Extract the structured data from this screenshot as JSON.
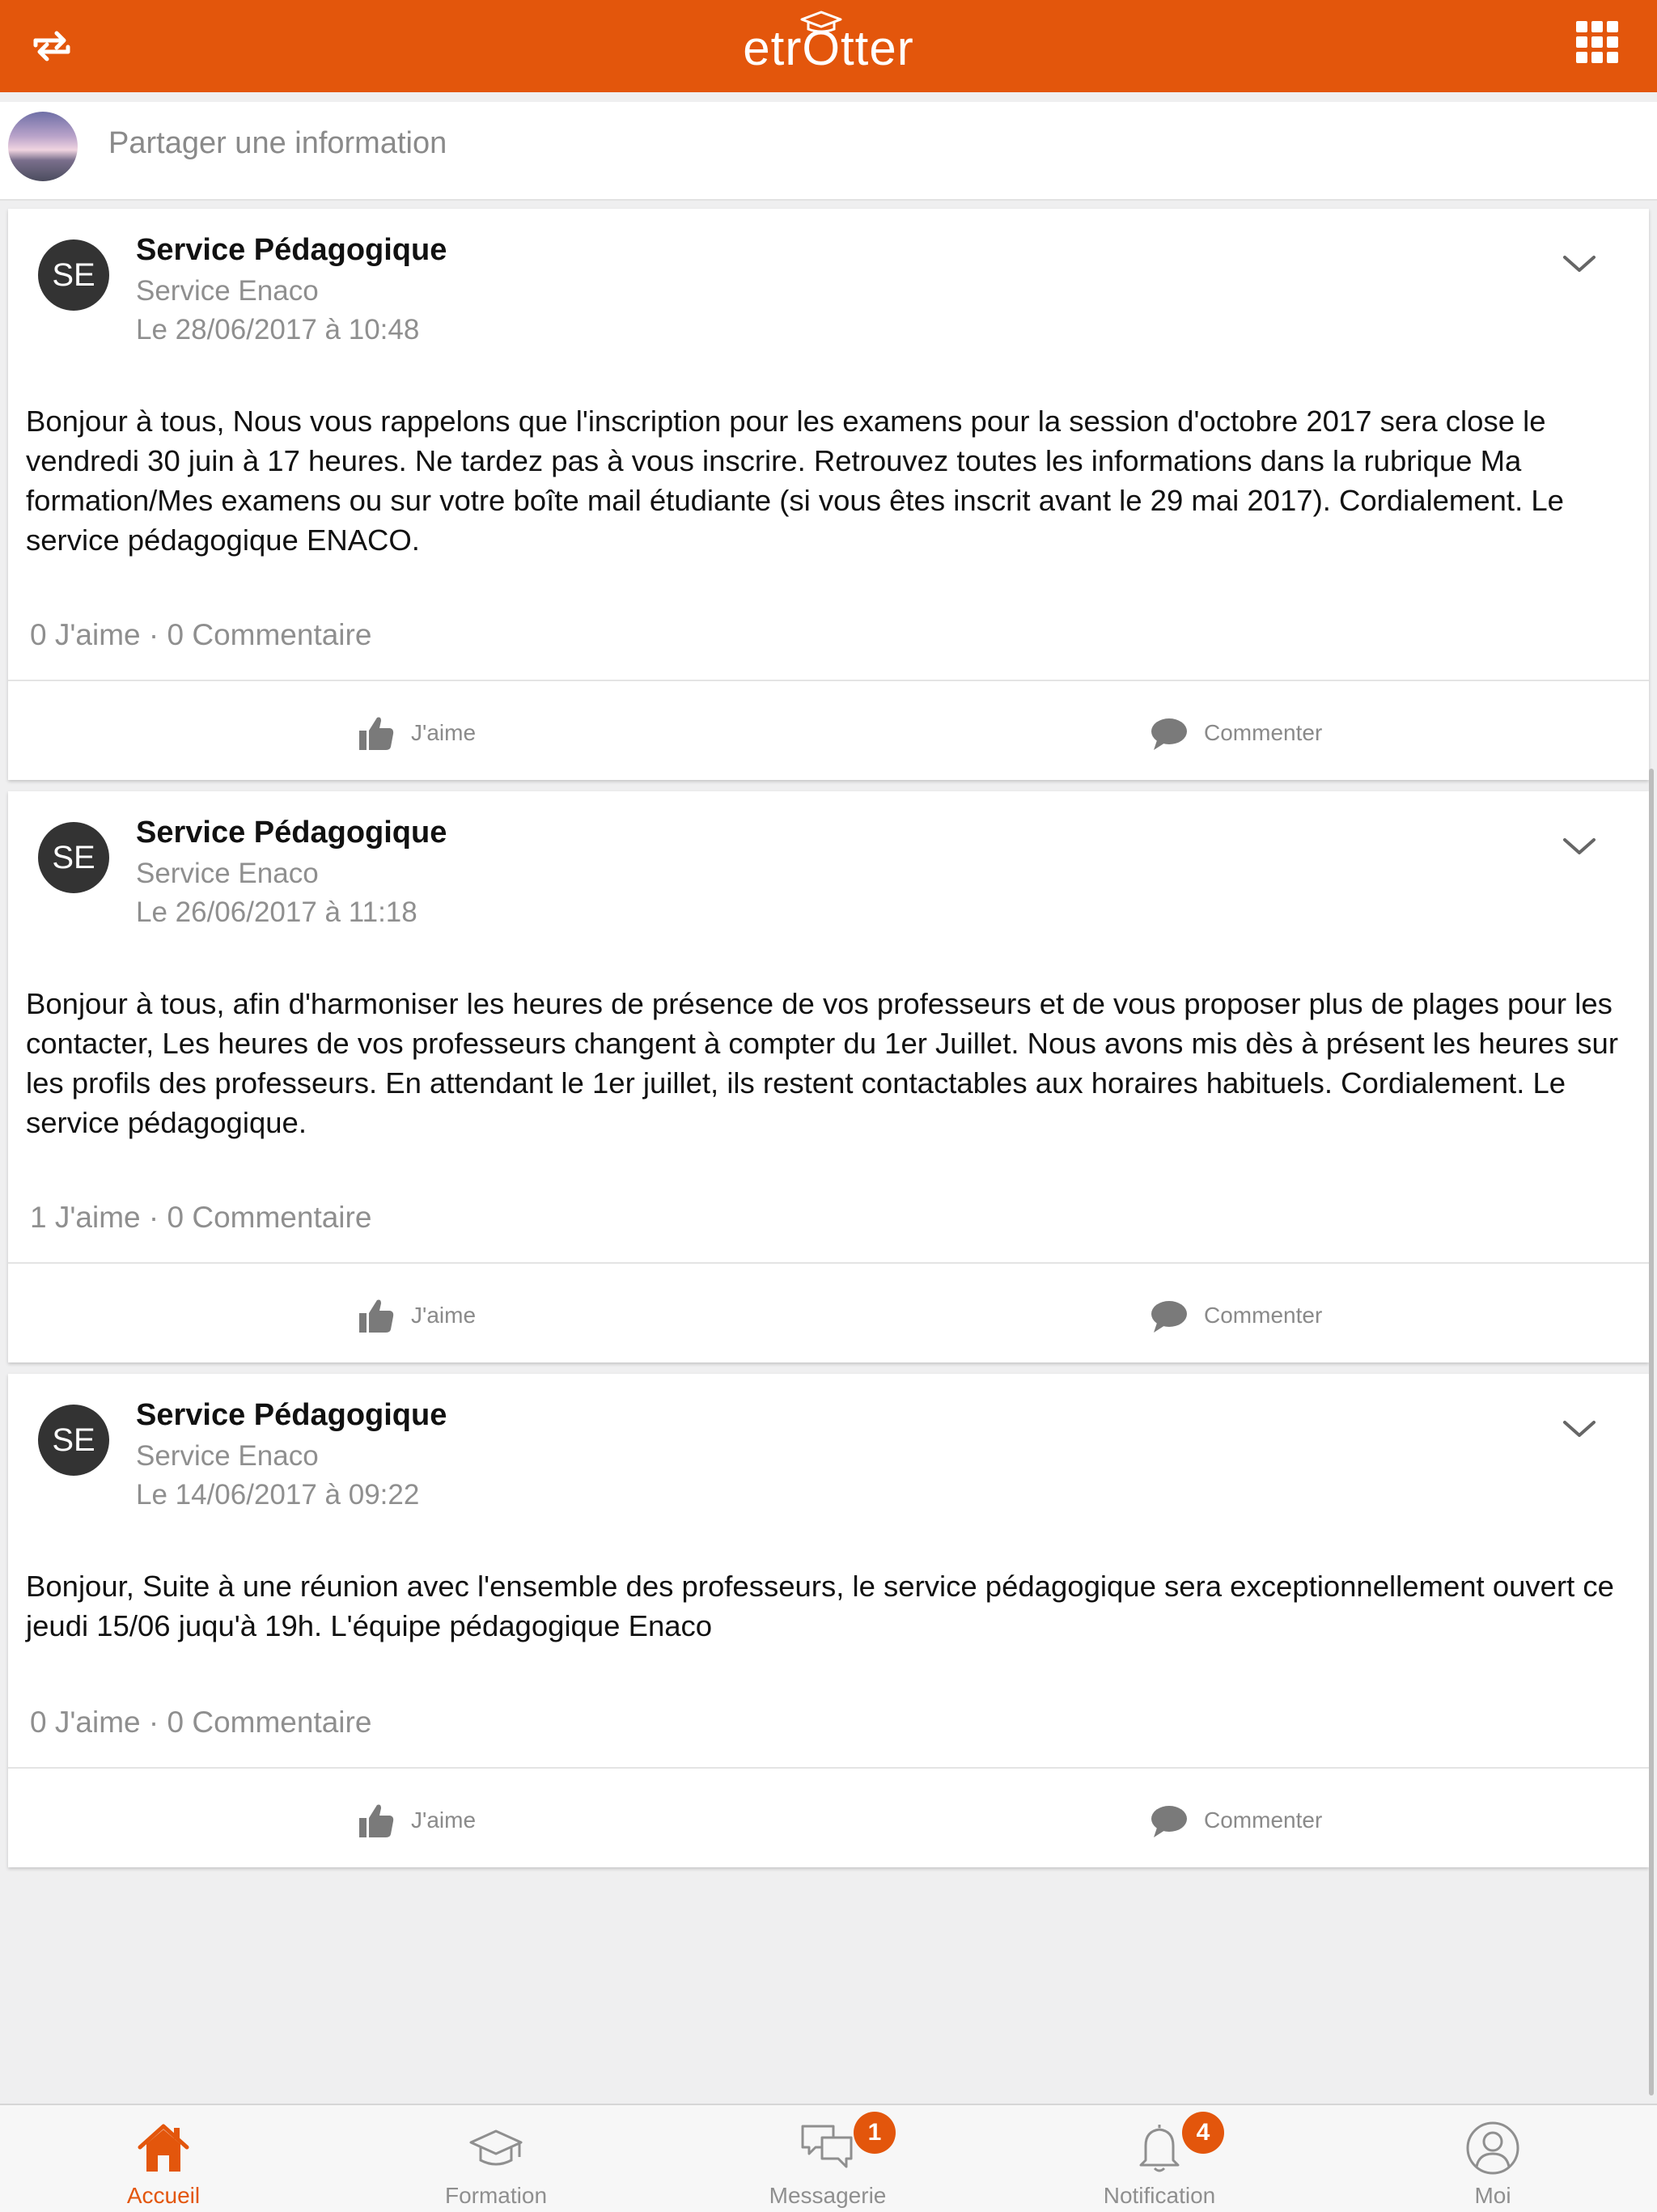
{
  "header": {
    "logo_text": "etrOtter",
    "switch_icon": "switch-arrows-icon",
    "apps_icon": "grid-apps-icon"
  },
  "share": {
    "placeholder": "Partager une information"
  },
  "posts": [
    {
      "avatar_initials": "SE",
      "author": "Service Pédagogique",
      "service": "Service Enaco",
      "date": "Le 28/06/2017 à 10:48",
      "body": "Bonjour à tous, Nous vous rappelons que l'inscription pour les examens pour la session d'octobre 2017 sera close le vendredi 30 juin à 17 heures. Ne tardez pas à vous inscrire. Retrouvez toutes les informations dans la rubrique Ma formation/Mes examens ou sur votre boîte mail étudiante (si vous êtes inscrit avant le 29 mai 2017). Cordialement. Le service pédagogique ENACO.",
      "stats": "0 J'aime · 0 Commentaire",
      "like_label": "J'aime",
      "comment_label": "Commenter"
    },
    {
      "avatar_initials": "SE",
      "author": "Service Pédagogique",
      "service": "Service Enaco",
      "date": "Le 26/06/2017 à 11:18",
      "body": "Bonjour à tous, afin d'harmoniser les heures de présence de vos professeurs et de vous proposer plus de plages pour les contacter, Les heures de vos professeurs changent à compter du 1er Juillet. Nous avons mis dès à présent les heures sur les profils des professeurs. En attendant le 1er juillet, ils restent contactables aux horaires habituels. Cordialement. Le service pédagogique.",
      "stats": "1 J'aime · 0 Commentaire",
      "like_label": "J'aime",
      "comment_label": "Commenter"
    },
    {
      "avatar_initials": "SE",
      "author": "Service Pédagogique",
      "service": "Service Enaco",
      "date": "Le 14/06/2017 à 09:22",
      "body": "Bonjour, Suite à une réunion avec l'ensemble des professeurs, le service pédagogique sera exceptionnellement ouvert ce jeudi 15/06 juqu'à 19h.  L'équipe pédagogique Enaco",
      "stats": "0 J'aime · 0 Commentaire",
      "like_label": "J'aime",
      "comment_label": "Commenter"
    }
  ],
  "tabs": [
    {
      "label": "Accueil",
      "icon": "home-icon",
      "active": true,
      "badge": ""
    },
    {
      "label": "Formation",
      "icon": "graduation-cap-icon",
      "active": false,
      "badge": ""
    },
    {
      "label": "Messagerie",
      "icon": "chat-bubbles-icon",
      "active": false,
      "badge": "1"
    },
    {
      "label": "Notification",
      "icon": "bell-icon",
      "active": false,
      "badge": "4"
    },
    {
      "label": "Moi",
      "icon": "user-icon",
      "active": false,
      "badge": ""
    }
  ],
  "colors": {
    "brand": "#e3560c",
    "text": "#111111",
    "muted": "#8f8f8f",
    "background": "#efeff0"
  }
}
